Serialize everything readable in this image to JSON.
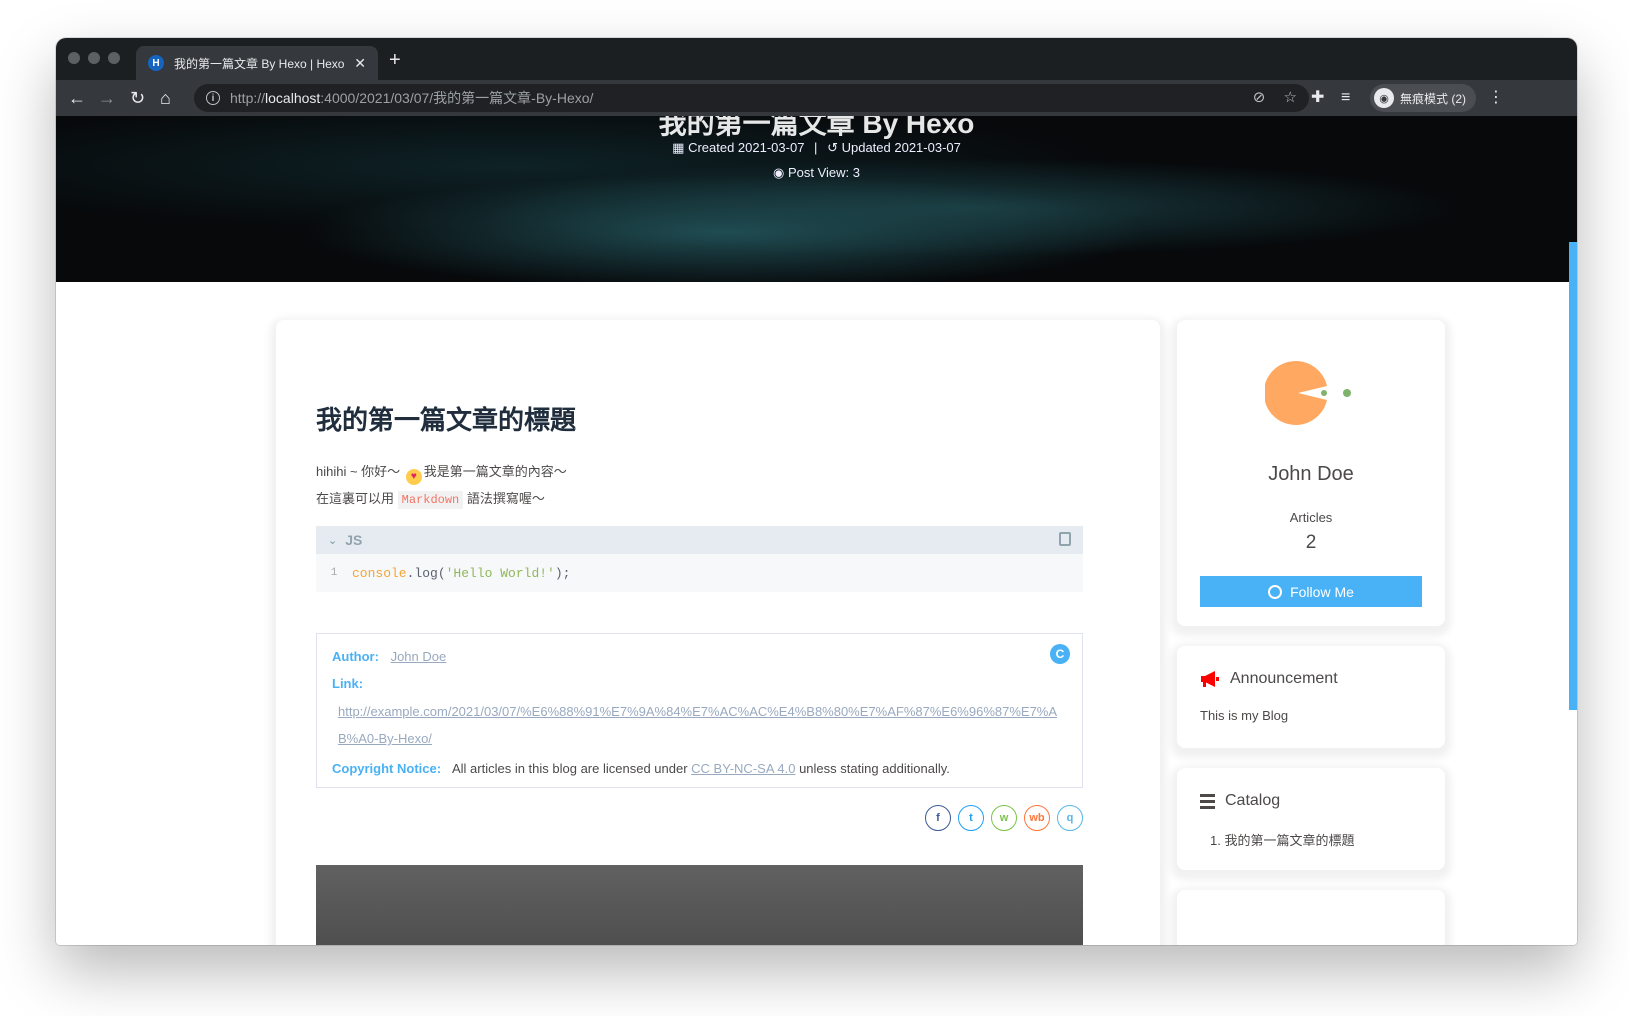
{
  "browser": {
    "tab_title": "我的第一篇文章 By Hexo | Hexo",
    "tab_favicon": "H",
    "new_tab": "+",
    "url_scheme": "http://",
    "url_host": "localhost",
    "url_path": ":4000/2021/03/07/我的第一篇文章-By-Hexo/",
    "profile_label": "無痕模式 (2)",
    "icons": [
      "back-icon",
      "forward-icon",
      "reload-icon",
      "home-icon",
      "info-icon",
      "eye-off-icon",
      "star-icon",
      "extensions-icon",
      "reading-list-icon",
      "menu-icon"
    ]
  },
  "hero": {
    "title_partial": "我的第一篇文章 By Hexo",
    "created": "Created 2021-03-07",
    "updated": "Updated 2021-03-07",
    "separator": "|",
    "views": "Post View: 3"
  },
  "post": {
    "title": "我的第一篇文章的標題",
    "line1_prefix": "hihihi ~ 你好～",
    "line1_suffix": "我是第一篇文章的內容～",
    "line2_prefix": "在這裏可以用",
    "line2_code": "Markdown",
    "line2_suffix": "語法撰寫喔～",
    "code": {
      "lang": "JS",
      "line_number": "1",
      "tok_obj": "console",
      "tok_fn": ".log(",
      "tok_str": "'Hello World!'",
      "tok_end": ");"
    },
    "copyright": {
      "author_label": "Author:",
      "author_value": "John Doe",
      "link_label": "Link:",
      "link_value": "http://example.com/2021/03/07/%E6%88%91%E7%9A%84%E7%AC%AC%E4%B8%80%E7%AF%87%E6%96%87%E7%AB%A0-By-Hexo/",
      "notice_label": "Copyright Notice:",
      "notice_prefix": "All articles in this blog are licensed under",
      "notice_link": "CC BY-NC-SA 4.0",
      "notice_suffix": "unless stating additionally.",
      "cc_icon": "C"
    },
    "share": [
      {
        "name": "facebook",
        "glyph": "f",
        "color": "#3b5998"
      },
      {
        "name": "twitter",
        "glyph": "t",
        "color": "#1da1f2"
      },
      {
        "name": "wechat",
        "glyph": "w",
        "color": "#7bc549"
      },
      {
        "name": "weibo",
        "glyph": "wb",
        "color": "#ff763b"
      },
      {
        "name": "qq",
        "glyph": "q",
        "color": "#56b6e7"
      }
    ]
  },
  "sidebar": {
    "author_name": "John Doe",
    "articles_label": "Articles",
    "articles_count": "2",
    "follow_label": "Follow Me",
    "announcement_title": "Announcement",
    "announcement_text": "This is my Blog",
    "catalog_title": "Catalog",
    "catalog_item": "1. 我的第一篇文章的標題"
  },
  "colors": {
    "accent": "#49b1f5",
    "megaphone": "#ff0000"
  }
}
